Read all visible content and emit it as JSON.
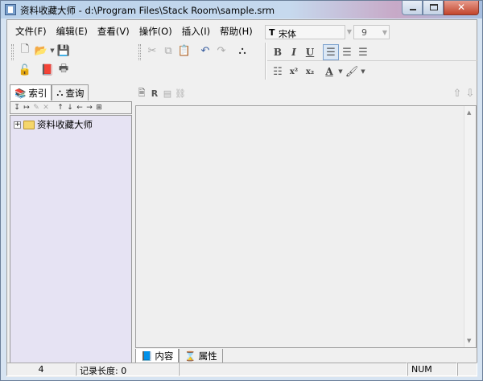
{
  "window": {
    "title": "资料收藏大师 - d:\\Program Files\\Stack Room\\sample.srm",
    "minimize": "minimize",
    "maximize": "maximize",
    "close": "close"
  },
  "menu": {
    "items": [
      "文件(F)",
      "编辑(E)",
      "查看(V)",
      "操作(O)",
      "插入(I)",
      "帮助(H)"
    ]
  },
  "format_bar": {
    "font_name": "宋体",
    "font_size": "9"
  },
  "left_tabs": [
    {
      "label": "索引",
      "icon": "book-stack-icon",
      "active": true
    },
    {
      "label": "查询",
      "icon": "binoculars-icon",
      "active": false
    }
  ],
  "tree": {
    "nodes": [
      {
        "label": "资料收藏大师",
        "expander": "+",
        "icon": "folder-icon"
      }
    ]
  },
  "bottom_tabs": [
    {
      "label": "内容",
      "icon": "book-icon",
      "active": true
    },
    {
      "label": "属性",
      "icon": "hourglass-icon",
      "active": false
    }
  ],
  "status": {
    "count": "4",
    "record_length": "记录长度: 0",
    "mode": "NUM"
  }
}
